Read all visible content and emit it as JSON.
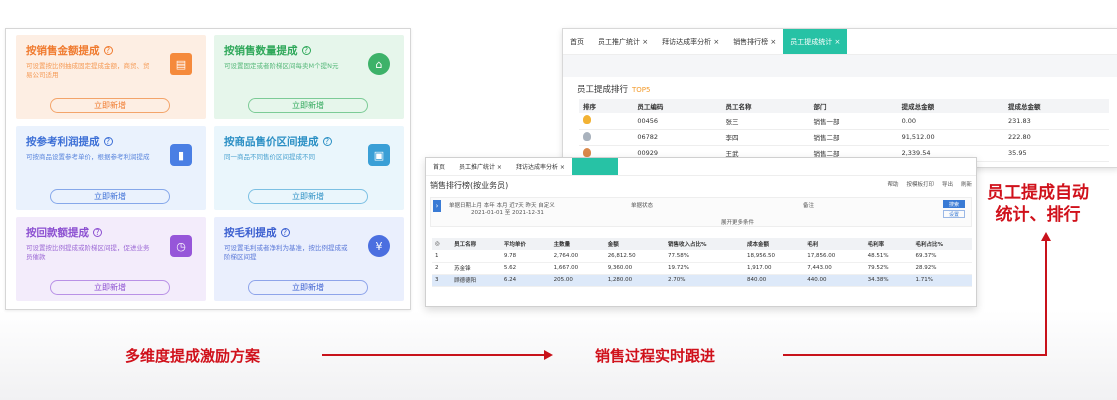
{
  "cards": [
    {
      "title": "按销售金额提成",
      "desc": "可设置按比例抽成固定提成金额，商贸、贸易公司适用",
      "button": "立即新增",
      "icon": "calendar-icon"
    },
    {
      "title": "按销售数量提成",
      "desc": "可设置固定或者阶梯区间每卖M个提N元",
      "button": "立即新增",
      "icon": "house-icon"
    },
    {
      "title": "按参考利润提成",
      "desc": "可按商品设置参考单价，根据参考利润提成",
      "button": "立即新增",
      "icon": "chart-icon"
    },
    {
      "title": "按商品售价区间提成",
      "desc": "同一商品不同售价区间提成不同",
      "button": "立即新增",
      "icon": "clipboard-icon"
    },
    {
      "title": "按回款额提成",
      "desc": "可设置按比例提成或阶梯区间提，促进业务员催款",
      "button": "立即新增",
      "icon": "clock-icon"
    },
    {
      "title": "按毛利提成",
      "desc": "可设置毛利或者净利为基准，按比例提成或阶梯区间提",
      "button": "立即新增",
      "icon": "money-bag-icon"
    }
  ],
  "win1": {
    "tabs": [
      "首页",
      "员工推广统计 ×",
      "拜访达成率分析 ×",
      "销售排行榜 ×",
      "员工提成统计 ×"
    ],
    "subtitle": "员工提成排行",
    "subtitle_tag": "TOP5",
    "headers": [
      "排序",
      "员工编码",
      "员工名称",
      "部门",
      "提成总金额",
      "提成总金额"
    ],
    "rows": [
      {
        "code": "00456",
        "name": "张三",
        "dept": "销售一部",
        "amount": "0.00",
        "total": "231.83"
      },
      {
        "code": "06782",
        "name": "李四",
        "dept": "销售二部",
        "amount": "91,512.00",
        "total": "222.80"
      },
      {
        "code": "00929",
        "name": "王武",
        "dept": "销售二部",
        "amount": "2,339.54",
        "total": "35.95"
      }
    ]
  },
  "win2": {
    "tabs": [
      "首页",
      "员工推广统计 ×",
      "拜访达成率分析 ×"
    ],
    "title": "销售排行榜(按业务员)",
    "tools": [
      "帮助",
      "按模板打印",
      "导出",
      "刷新"
    ],
    "filter_date_label": "单据日期",
    "filter_quick": "上月 本年 本月 近7天 昨天 自定义",
    "filter_range": "2021-01-01 至 2021-12-31",
    "filter_status_label": "单据状态",
    "filter_remark_label": "备注",
    "filter_more": "展开更多条件",
    "search_btn": "搜索",
    "reset_btn": "设置",
    "headers": [
      "员工名称",
      "平均单价",
      "主数量",
      "金额",
      "销售收入占比%",
      "成本金额",
      "毛利",
      "毛利率",
      "毛利占比%"
    ],
    "rows": [
      {
        "idx": "1",
        "name": "",
        "price": "9.78",
        "qty": "2,764.00",
        "amt": "26,812.50",
        "ratio": "77.58%",
        "cost": "18,956.50",
        "profit": "17,856.00",
        "rate": "48.51%",
        "share": "69.37%"
      },
      {
        "idx": "2",
        "name": "苏金锋",
        "price": "5.62",
        "qty": "1,667.00",
        "amt": "9,360.00",
        "ratio": "19.72%",
        "cost": "1,917.00",
        "profit": "7,443.00",
        "rate": "79.52%",
        "share": "28.92%"
      },
      {
        "idx": "3",
        "name": "顾德德阳",
        "price": "6.24",
        "qty": "205.00",
        "amt": "1,280.00",
        "ratio": "2.70%",
        "cost": "840.00",
        "profit": "440.00",
        "rate": "34.38%",
        "share": "1.71%"
      }
    ]
  },
  "labels": {
    "left": "多维度提成激励方案",
    "middle": "销售过程实时跟进",
    "right_line1": "员工提成自动",
    "right_line2": "统计、排行"
  }
}
